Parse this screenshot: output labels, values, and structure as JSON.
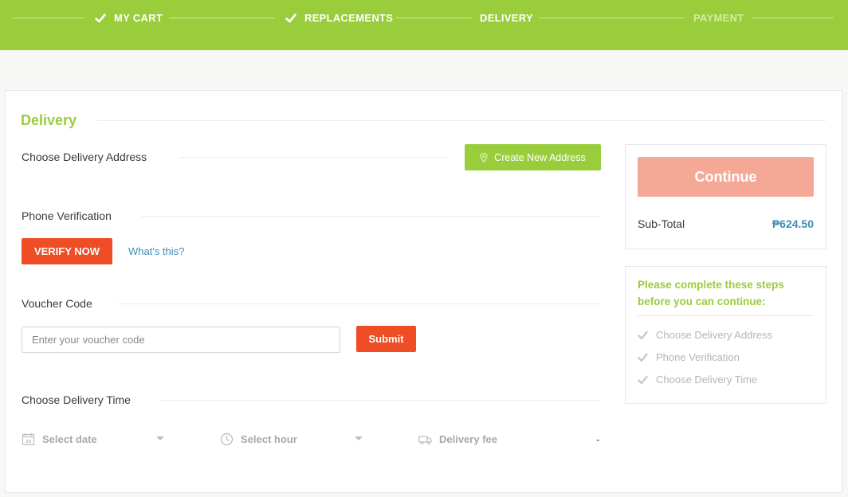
{
  "header": {
    "steps": [
      {
        "label": "MY CART",
        "done": true
      },
      {
        "label": "REPLACEMENTS",
        "done": true
      },
      {
        "label": "DELIVERY",
        "done": false,
        "current": true
      },
      {
        "label": "PAYMENT",
        "done": false
      }
    ]
  },
  "colors": {
    "brand_green": "#9acd3c",
    "accent_red": "#ee4d26",
    "continue_disabled": "#f6a896",
    "link_blue": "#3d8db5"
  },
  "main": {
    "title": "Delivery",
    "address": {
      "label": "Choose Delivery Address",
      "button": "Create New Address",
      "icon": "map-pin-icon"
    },
    "phone": {
      "label": "Phone Verification",
      "verify_button": "VERIFY NOW",
      "help_link": "What's this?"
    },
    "voucher": {
      "label": "Voucher Code",
      "placeholder": "Enter your voucher code",
      "submit": "Submit"
    },
    "delivery_time": {
      "label": "Choose Delivery Time",
      "date": {
        "label": "Select date",
        "icon": "calendar-icon",
        "calendar_day": "23"
      },
      "hour": {
        "label": "Select hour",
        "icon": "clock-icon"
      },
      "fee": {
        "label": "Delivery fee",
        "icon": "truck-icon",
        "value": "-"
      }
    }
  },
  "summary": {
    "continue_button": "Continue",
    "subtotal_label": "Sub-Total",
    "subtotal_value": "₱624.50"
  },
  "requirements": {
    "heading": "Please complete these steps before you can continue:",
    "items": [
      "Choose Delivery Address",
      "Phone Verification",
      "Choose Delivery Time"
    ]
  }
}
